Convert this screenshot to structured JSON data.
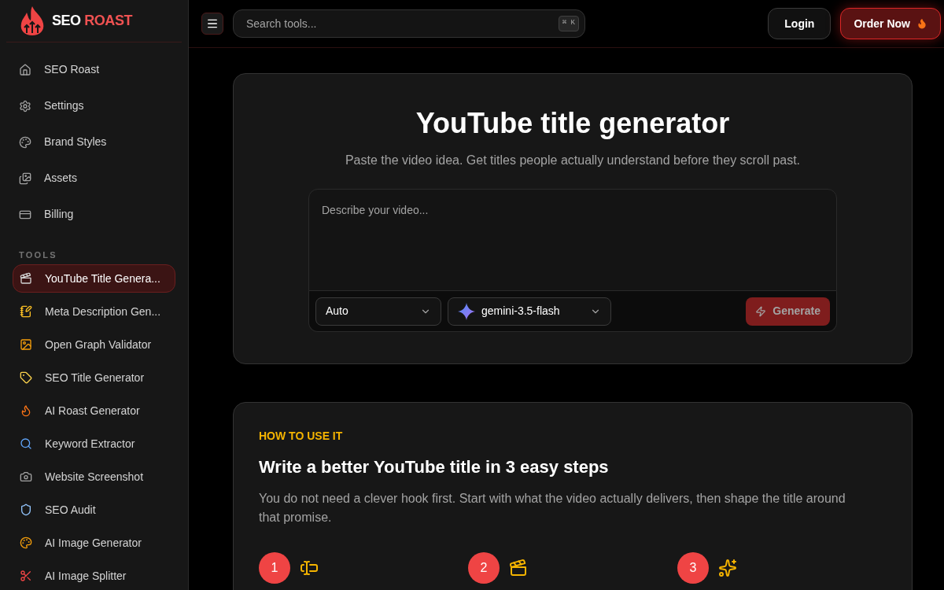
{
  "brand": {
    "first": "SEO",
    "second": "ROAST"
  },
  "nav": [
    {
      "label": "SEO Roast",
      "kind": "home"
    },
    {
      "label": "Settings",
      "kind": "settings"
    },
    {
      "label": "Brand Styles",
      "kind": "palette"
    },
    {
      "label": "Assets",
      "kind": "images"
    },
    {
      "label": "Billing",
      "kind": "card"
    }
  ],
  "tools_heading": "TOOLS",
  "tools": [
    {
      "label": "YouTube Title Genera...",
      "kind": "clapper",
      "selected": true
    },
    {
      "label": "Meta Description Gen...",
      "kind": "note",
      "selected": false
    },
    {
      "label": "Open Graph Validator",
      "kind": "image",
      "selected": false
    },
    {
      "label": "SEO Title Generator",
      "kind": "tag",
      "selected": false
    },
    {
      "label": "AI Roast Generator",
      "kind": "flame",
      "selected": false
    },
    {
      "label": "Keyword Extractor",
      "kind": "magnifier",
      "selected": false
    },
    {
      "label": "Website Screenshot",
      "kind": "camera",
      "selected": false
    },
    {
      "label": "SEO Audit",
      "kind": "shield",
      "selected": false
    },
    {
      "label": "AI Image Generator",
      "kind": "palette",
      "selected": false
    },
    {
      "label": "AI Image Splitter",
      "kind": "scissors",
      "selected": false
    }
  ],
  "search": {
    "placeholder": "Search tools...",
    "shortcut": "⌘ K"
  },
  "header_buttons": {
    "login": "Login",
    "order": "Order Now"
  },
  "generator": {
    "title": "YouTube title generator",
    "subtitle": "Paste the video idea. Get titles people actually understand before they scroll past.",
    "placeholder": "Describe your video...",
    "mode": "Auto",
    "model": "gemini-3.5-flash",
    "generate": "Generate",
    "generate_disabled": true
  },
  "howto": {
    "eyebrow": "HOW TO USE IT",
    "title": "Write a better YouTube title in 3 easy steps",
    "body": "You do not need a clever hook first. Start with what the video actually delivers, then shape the title around that promise.",
    "steps": [
      {
        "number": "1",
        "kind": "text-cursor"
      },
      {
        "number": "2",
        "kind": "clapper"
      },
      {
        "number": "3",
        "kind": "sparkles"
      }
    ]
  }
}
